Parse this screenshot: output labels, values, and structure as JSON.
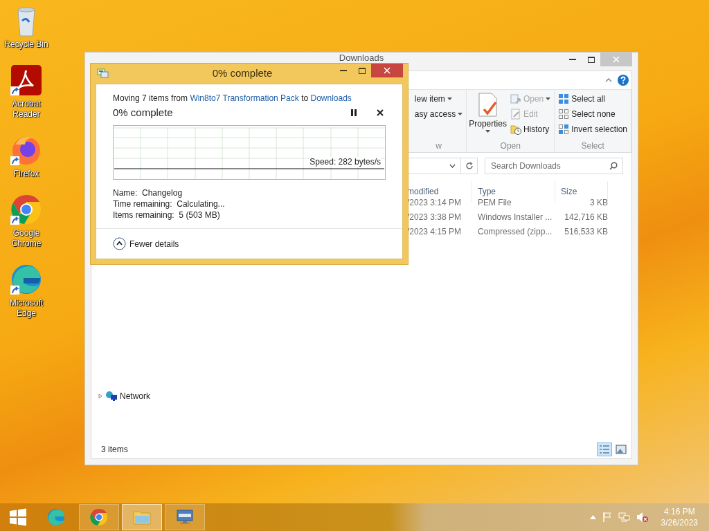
{
  "desktop_icons": [
    {
      "kind": "recycle",
      "label": "Recycle Bin",
      "shortcut": false
    },
    {
      "kind": "acrobat",
      "label": "Acrobat Reader",
      "shortcut": true
    },
    {
      "kind": "firefox",
      "label": "Firefox",
      "shortcut": true
    },
    {
      "kind": "chrome",
      "label": "Google Chrome",
      "shortcut": true
    },
    {
      "kind": "edge",
      "label": "Microsoft Edge",
      "shortcut": true
    }
  ],
  "explorer": {
    "title": "Downloads",
    "ribbon": {
      "groups": [
        {
          "label": "w",
          "items": [
            {
              "kind": "small",
              "label": "lew item",
              "caret": true,
              "disabled": false
            },
            {
              "kind": "small",
              "label": "asy access",
              "caret": true,
              "disabled": false
            }
          ]
        },
        {
          "label": "Open",
          "items": [
            {
              "kind": "large",
              "label": "Properties",
              "caret": true,
              "disabled": false
            },
            {
              "kind": "small",
              "label": "Open",
              "caret": true,
              "disabled": true
            },
            {
              "kind": "small",
              "label": "Edit",
              "caret": false,
              "disabled": true
            },
            {
              "kind": "small",
              "label": "History",
              "caret": false,
              "disabled": false
            }
          ]
        },
        {
          "label": "Select",
          "items": [
            {
              "kind": "small",
              "label": "Select all",
              "caret": false,
              "disabled": false
            },
            {
              "kind": "small",
              "label": "Select none",
              "caret": false,
              "disabled": false
            },
            {
              "kind": "small",
              "label": "Invert selection",
              "caret": false,
              "disabled": false
            }
          ]
        }
      ]
    },
    "search": {
      "placeholder": "Search Downloads"
    },
    "columns": [
      "modified",
      "Type",
      "Size"
    ],
    "rows": [
      {
        "modified": "/2023 3:14 PM",
        "type": "PEM File",
        "size": "3 KB"
      },
      {
        "modified": "/2023 3:38 PM",
        "type": "Windows Installer ...",
        "size": "142,716 KB"
      },
      {
        "modified": "/2023 4:15 PM",
        "type": "Compressed (zipp...",
        "size": "516,533 KB"
      }
    ],
    "nav": [
      {
        "label": "Network",
        "expanded": false
      }
    ],
    "status": "3 items",
    "views": [
      {
        "kind": "details",
        "selected": true
      },
      {
        "kind": "large",
        "selected": false
      }
    ]
  },
  "dialog": {
    "title": "0% complete",
    "prefix": "Moving 7 items from",
    "source": "Win8to7 Transformation Pack",
    "joiner": "to",
    "destination": "Downloads",
    "heading": "0% complete",
    "paused": false,
    "speed": "Speed: 282 bytes/s",
    "details": [
      "Name:  Changelog",
      "Time remaining:  Calculating...",
      "Items remaining:  5 (503 MB)"
    ],
    "toggle": {
      "label": "Fewer details",
      "expanded": true
    }
  },
  "taskbar": {
    "apps": [
      {
        "kind": "edge",
        "running": false,
        "selected": false
      },
      {
        "kind": "chrome",
        "running": true,
        "selected": false
      },
      {
        "kind": "explorer",
        "running": true,
        "selected": true
      },
      {
        "kind": "remote",
        "running": true,
        "selected": false
      }
    ],
    "time": "4:16 PM",
    "date": "3/26/2023"
  }
}
